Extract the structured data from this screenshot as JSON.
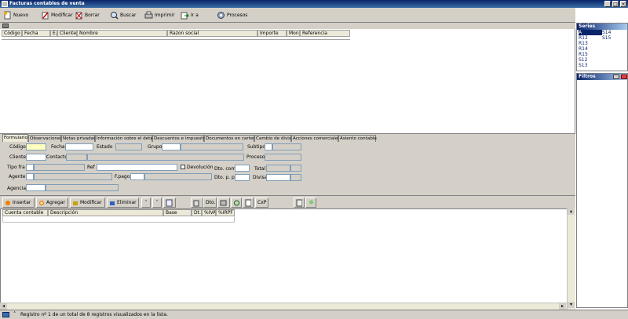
{
  "window": {
    "title": "Facturas contables de venta"
  },
  "toolbar": {
    "items": [
      "Nuevo",
      "Modificar",
      "Borrar",
      "Buscar",
      "Imprimir",
      "Ir a",
      "Procesos"
    ]
  },
  "grid": {
    "columns": [
      "Código",
      "Fecha",
      "E.",
      "Cliente",
      "Nombre",
      "Razon social",
      "Importe",
      "Mon.",
      "Referencia"
    ]
  },
  "series": {
    "title": "Series",
    "items": [
      "A",
      "R12",
      "R13",
      "R14",
      "R15",
      "S12",
      "S13",
      "S14",
      "S15"
    ]
  },
  "filtros": {
    "title": "Filtros"
  },
  "tabs": [
    "Formulario",
    "Observaciones",
    "Notas privadas",
    "Información sobre el detalle",
    "Descuentos e impuestos",
    "Documentos en cartera",
    "Cambio de divisa",
    "Acciones comerciales",
    "Asiento contable"
  ],
  "form": {
    "codigo": "Código",
    "fecha": "Fecha",
    "estado": "Estado",
    "grupo": "Grupo",
    "subtipo": "Subtipo",
    "cliente": "Cliente",
    "contacto": "Contacto",
    "proceso": "Proceso",
    "tipo_fra": "Tipo fra",
    "ref": "Ref",
    "devolucion": "Devolución",
    "total": "Total",
    "dto_com": "Dto. com.",
    "agente": "Agente",
    "f_pago": "F.pago",
    "dto_pp": "Dto. p. p.",
    "divisa": "Divisa",
    "agencia": "Agencia"
  },
  "detail_toolbar": {
    "insertar": "Insertar",
    "agregar": "Agregar",
    "modificar": "Modificar",
    "eliminar": "Eliminar",
    "dto": "Dto.",
    "cxp": "CxP"
  },
  "detail_grid": {
    "columns": [
      "Cuenta contable",
      "Descripción",
      "Base",
      "Dt.1",
      "%IVA",
      "%IRPF"
    ]
  },
  "status": {
    "text": "Registro nº 1 de un total de 8 registros visualizados en la lista."
  },
  "colors": {
    "titlebar": "#0a246a",
    "chrome": "#d4d0c8",
    "selection": "#0a246a",
    "highlight": "#ffffc0"
  }
}
